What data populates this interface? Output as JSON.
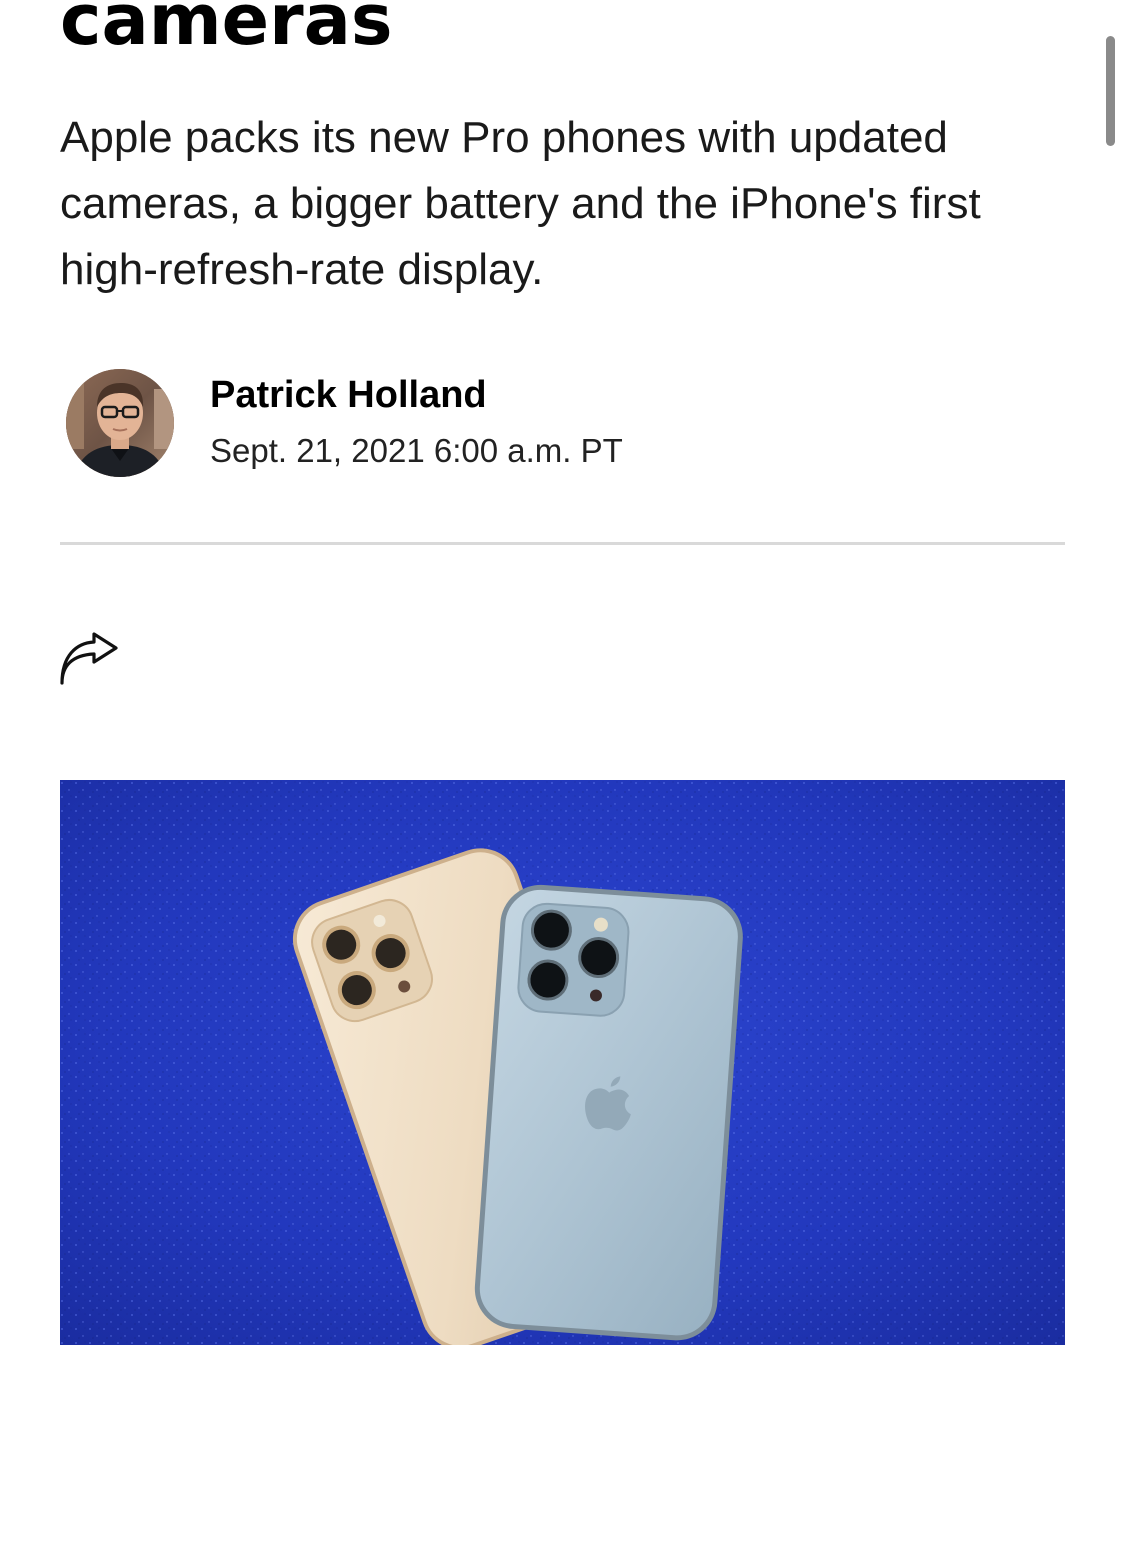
{
  "article": {
    "headline_tail": "cameras",
    "dek": "Apple packs its new Pro phones with updated cameras, a bigger battery and the iPhone's first high-refresh-rate display.",
    "author": {
      "name": "Patrick Holland",
      "avatar_icon": "author-avatar"
    },
    "published": "Sept. 21, 2021 6:00 a.m. PT"
  },
  "actions": {
    "share_icon": "share-arrow-icon"
  },
  "hero_image": {
    "subject": "iPhone-13-pro-photo"
  },
  "colors": {
    "background": "#ffffff",
    "text": "#111111",
    "divider": "#d9d9d9",
    "hero_background": "#1f34b8",
    "gold_phone": "#eedcc2",
    "blue_phone": "#a9c0cf"
  }
}
